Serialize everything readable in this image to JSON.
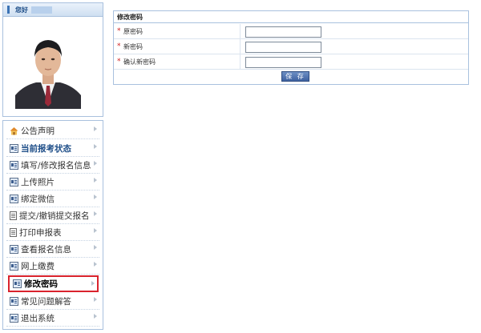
{
  "welcome": {
    "text": "您好"
  },
  "panel": {
    "title": "修改密码",
    "fields": [
      {
        "required_mark": "*",
        "label": "原密码",
        "value": ""
      },
      {
        "required_mark": "*",
        "label": "新密码",
        "value": ""
      },
      {
        "required_mark": "*",
        "label": "确认新密码",
        "value": ""
      }
    ],
    "save_label": "保 存"
  },
  "menu": {
    "items": [
      {
        "label": "公告声明",
        "icon": "home-icon"
      },
      {
        "label": "当前报考状态",
        "icon": "card-icon"
      },
      {
        "label": "填写/修改报名信息",
        "icon": "card-icon"
      },
      {
        "label": "上传照片",
        "icon": "card-icon"
      },
      {
        "label": "绑定微信",
        "icon": "card-icon"
      },
      {
        "label": "提交/撤销提交报名",
        "icon": "document-icon"
      },
      {
        "label": "打印申报表",
        "icon": "document-icon"
      },
      {
        "label": "查看报名信息",
        "icon": "card-icon"
      },
      {
        "label": "网上缴费",
        "icon": "card-icon"
      },
      {
        "label": "修改密码",
        "icon": "card-icon"
      },
      {
        "label": "常见问题解答",
        "icon": "card-icon"
      },
      {
        "label": "退出系统",
        "icon": "card-icon"
      }
    ]
  },
  "colors": {
    "accent": "#3b73b5",
    "highlight_border": "#d9232d",
    "required": "#d02020"
  }
}
